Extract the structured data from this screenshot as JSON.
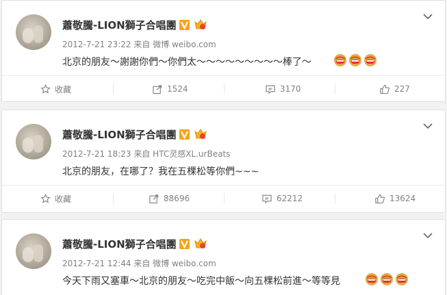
{
  "colors": {
    "badge_v": "#f7a21b",
    "text": "#333333",
    "meta": "#808080",
    "background": "#f2f2f2"
  },
  "posts": [
    {
      "author": "蕭敬騰-LION獅子合唱團",
      "date": "2012-7-21 23:22",
      "source_prefix": "来自",
      "source": "微博 weibo.com",
      "text": "北京的朋友～謝謝你們～你們太～～～～～～～～～棒了～",
      "emoji_count": 3,
      "actions": {
        "favorite": "收藏",
        "repost": "1524",
        "comment": "3170",
        "like": "227"
      }
    },
    {
      "author": "蕭敬騰-LION獅子合唱團",
      "date": "2012-7-21 18:23",
      "source_prefix": "来自",
      "source": "HTC灵感XL.urBeats",
      "text": "北京的朋友，在哪了？我在五棵松等你們~~~",
      "emoji_count": 0,
      "actions": {
        "favorite": "收藏",
        "repost": "88696",
        "comment": "62212",
        "like": "13624"
      }
    },
    {
      "author": "蕭敬騰-LION獅子合唱團",
      "date": "2012-7-21 12:44",
      "source_prefix": "来自",
      "source": "微博 weibo.com",
      "text": "今天下雨又塞車～北京的朋友～吃完中飯～向五棵松前進～等等見",
      "emoji_count": 3,
      "actions": {
        "favorite": "收藏",
        "repost": "",
        "comment": "",
        "like": ""
      }
    }
  ]
}
